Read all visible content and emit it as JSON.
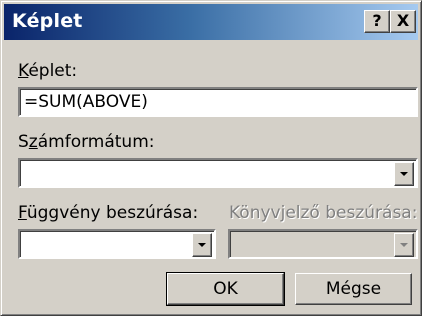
{
  "window": {
    "title": "Képlet",
    "help_label": "?",
    "close_label": "X"
  },
  "formula": {
    "label_mnemonic": "K",
    "label_rest": "éplet:",
    "value": "=SUM(ABOVE)"
  },
  "number_format": {
    "label_pre": "S",
    "label_mnemonic": "z",
    "label_rest": "ámformátum:",
    "value": ""
  },
  "paste_function": {
    "label_mnemonic": "F",
    "label_rest": "üggvény beszúrása:",
    "value": ""
  },
  "paste_bookmark": {
    "label": "Könyvjelző beszúrása:",
    "value": ""
  },
  "buttons": {
    "ok_label": "OK",
    "cancel_label": "Mégse"
  }
}
